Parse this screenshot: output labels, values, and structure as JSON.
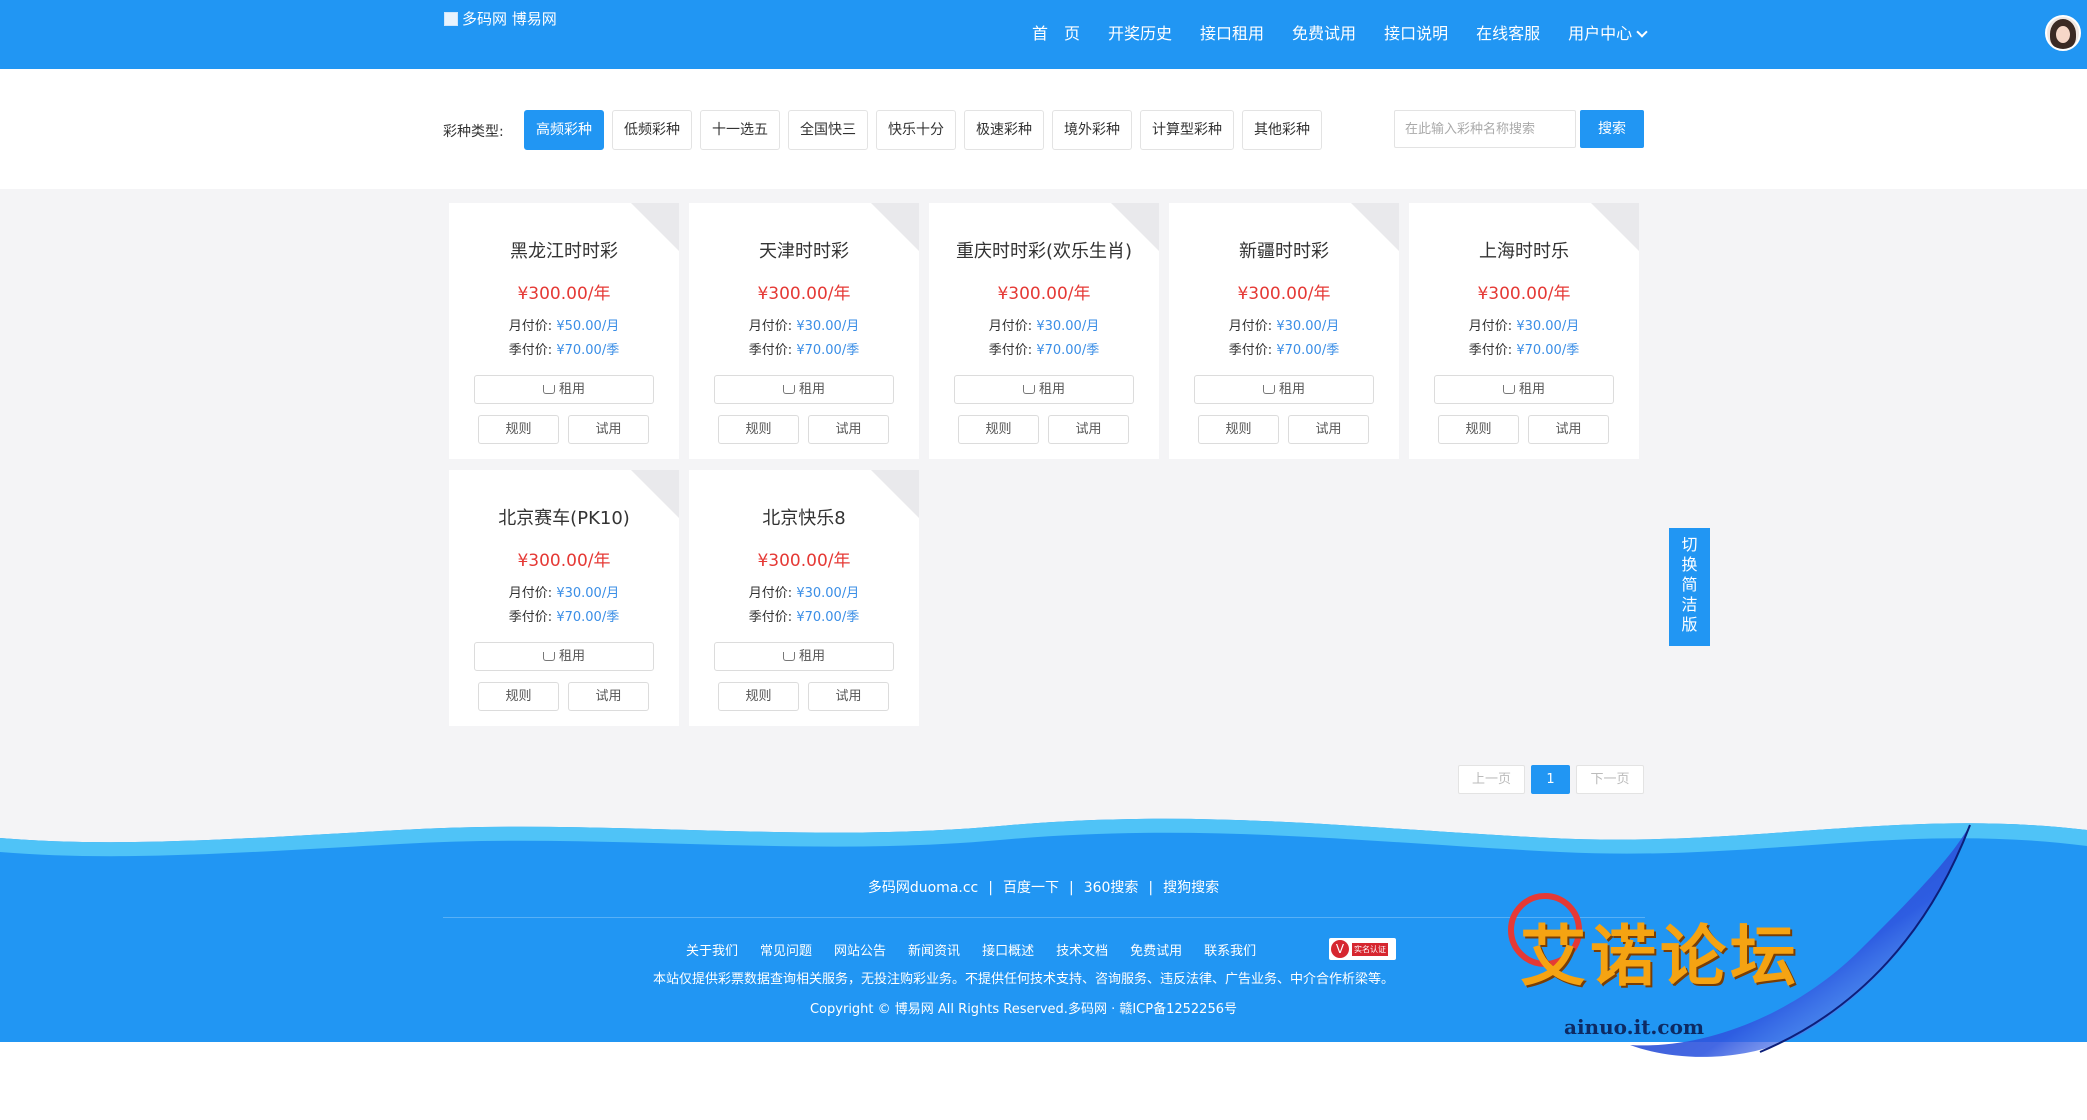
{
  "header": {
    "logo_alt": "多码网 博易网",
    "nav": [
      {
        "label": "首　页"
      },
      {
        "label": "开奖历史"
      },
      {
        "label": "接口租用"
      },
      {
        "label": "免费试用"
      },
      {
        "label": "接口说明"
      },
      {
        "label": "在线客服"
      },
      {
        "label": "用户中心"
      }
    ],
    "avatar": "user-avatar"
  },
  "filter": {
    "label": "彩种类型:",
    "categories": [
      "高频彩种",
      "低频彩种",
      "十一选五",
      "全国快三",
      "快乐十分",
      "极速彩种",
      "境外彩种",
      "计算型彩种",
      "其他彩种"
    ],
    "active_index": 0,
    "search_placeholder": "在此输入彩种名称搜索",
    "search_button": "搜索"
  },
  "cards": [
    {
      "title": "黑龙江时时彩",
      "year_price": "¥300.00/年",
      "month_label": "月付价:",
      "month_price": "¥50.00/月",
      "season_label": "季付价:",
      "season_price": "¥70.00/季",
      "rent": "租用",
      "rules": "规则",
      "trial": "试用"
    },
    {
      "title": "天津时时彩",
      "year_price": "¥300.00/年",
      "month_label": "月付价:",
      "month_price": "¥30.00/月",
      "season_label": "季付价:",
      "season_price": "¥70.00/季",
      "rent": "租用",
      "rules": "规则",
      "trial": "试用"
    },
    {
      "title": "重庆时时彩(欢乐生肖)",
      "year_price": "¥300.00/年",
      "month_label": "月付价:",
      "month_price": "¥30.00/月",
      "season_label": "季付价:",
      "season_price": "¥70.00/季",
      "rent": "租用",
      "rules": "规则",
      "trial": "试用"
    },
    {
      "title": "新疆时时彩",
      "year_price": "¥300.00/年",
      "month_label": "月付价:",
      "month_price": "¥30.00/月",
      "season_label": "季付价:",
      "season_price": "¥70.00/季",
      "rent": "租用",
      "rules": "规则",
      "trial": "试用"
    },
    {
      "title": "上海时时乐",
      "year_price": "¥300.00/年",
      "month_label": "月付价:",
      "month_price": "¥30.00/月",
      "season_label": "季付价:",
      "season_price": "¥70.00/季",
      "rent": "租用",
      "rules": "规则",
      "trial": "试用"
    },
    {
      "title": "北京赛车(PK10)",
      "year_price": "¥300.00/年",
      "month_label": "月付价:",
      "month_price": "¥30.00/月",
      "season_label": "季付价:",
      "season_price": "¥70.00/季",
      "rent": "租用",
      "rules": "规则",
      "trial": "试用"
    },
    {
      "title": "北京快乐8",
      "year_price": "¥300.00/年",
      "month_label": "月付价:",
      "month_price": "¥30.00/月",
      "season_label": "季付价:",
      "season_price": "¥70.00/季",
      "rent": "租用",
      "rules": "规则",
      "trial": "试用"
    }
  ],
  "side_switch": [
    "切",
    "换",
    "简",
    "洁",
    "版"
  ],
  "pagination": {
    "prev": "上一页",
    "current": "1",
    "next": "下一页"
  },
  "footer": {
    "links1": [
      "多码网duoma.cc",
      "百度一下",
      "360搜索",
      "搜狗搜索"
    ],
    "links1_sep": "|",
    "links2": [
      "关于我们",
      "常见问题",
      "网站公告",
      "新闻资讯",
      "接口概述",
      "技术文档",
      "免费试用",
      "联系我们"
    ],
    "badge_letter": "V",
    "badge_text": "实名认证",
    "notice": "本站仅提供彩票数据查询相关服务，无投注购彩业务。不提供任何技术支持、咨询服务、违反法律、广告业务、中介合作析梁等。",
    "copyright": "Copyright © 博易网 All Rights Reserved.多码网 · 赣ICP备1252256号"
  },
  "watermark": {
    "title": "艾诺论坛",
    "url": "ainuo.it.com"
  },
  "colors": {
    "primary": "#2196f3",
    "price_red": "#e53935",
    "price_blue": "#3a8ee6",
    "bg_gray": "#f4f4f6",
    "watermark_orange": "#f5a312"
  }
}
